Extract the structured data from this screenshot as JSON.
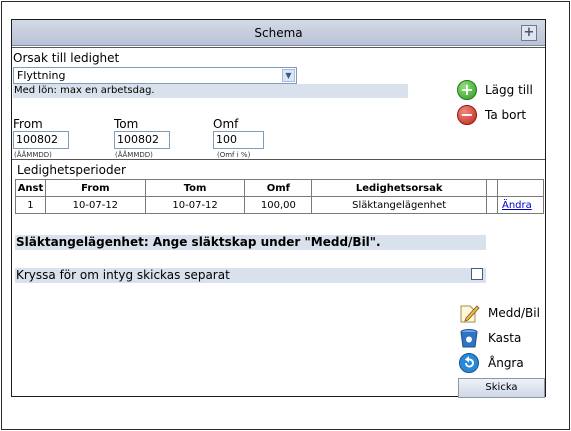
{
  "header": {
    "title": "Schema"
  },
  "reason": {
    "label": "Orsak till ledighet",
    "selected": "Flyttning",
    "info": "Med lön: max en arbetsdag."
  },
  "period_inputs": {
    "from": {
      "label": "From",
      "value": "100802",
      "hint": "(ÅÅMMDD)"
    },
    "tom": {
      "label": "Tom",
      "value": "100802",
      "hint": "(ÅÅMMDD)"
    },
    "omf": {
      "label": "Omf",
      "value": "100",
      "hint": "(Omf i %)"
    }
  },
  "actions": {
    "add": "Lägg till",
    "remove": "Ta bort"
  },
  "periods": {
    "title": "Ledighetsperioder",
    "columns": [
      "Anst",
      "From",
      "Tom",
      "Omf",
      "Ledighetsorsak",
      "",
      ""
    ],
    "rows": [
      {
        "anst": "1",
        "from": "10-07-12",
        "tom": "10-07-12",
        "omf": "100,00",
        "reason": "Släktangelägenhet",
        "extra": "",
        "action": "Ändra"
      }
    ]
  },
  "notice": "Släktangelägenhet: Ange släktskap under \"Medd/Bil\".",
  "certificate": {
    "label": "Kryssa för om intyg skickas separat",
    "checked": false
  },
  "tools": {
    "message": "Medd/Bil",
    "discard": "Kasta",
    "undo": "Ångra",
    "send": "Skicka"
  },
  "colors": {
    "title_bar": "#c5cddc",
    "info_band": "#d9e1ec",
    "link": "#0000cc"
  },
  "icons": [
    "expand-icon",
    "dropdown-arrow-icon",
    "add-icon",
    "remove-icon",
    "note-pencil-icon",
    "trash-icon",
    "undo-icon"
  ]
}
